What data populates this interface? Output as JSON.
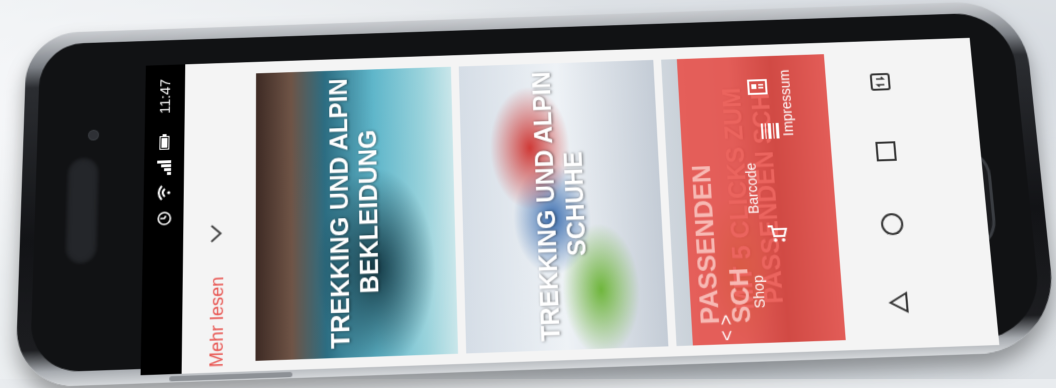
{
  "status_bar": {
    "time": "11:47",
    "icons": [
      "alarm-icon",
      "wifi-icon",
      "signal-icon",
      "battery-icon"
    ]
  },
  "app_bar": {
    "more_label": "Mehr lesen",
    "chevron": "chevron-down-icon"
  },
  "cards": [
    {
      "title": "TREKKING UND ALPIN BEKLEIDUNG"
    },
    {
      "title": "TREKKING UND ALPIN SCHUHE"
    },
    {
      "title": "MIT 5 CLICKS ZUM PASSENDEN SCH"
    }
  ],
  "red_bar": {
    "title_fragment": "PASSENDEN SCH",
    "nav_arrows": "< >",
    "tabs": [
      {
        "label": "Shop",
        "icon": "cart-icon"
      },
      {
        "label": "Barcode",
        "icon": "barcode-icon"
      },
      {
        "label": "Impressum",
        "icon": "info-card-icon"
      }
    ]
  },
  "system_nav": {
    "buttons": [
      "back-icon",
      "home-icon",
      "recents-icon",
      "rotate-icon"
    ]
  },
  "colors": {
    "accent": "#e8534f",
    "red_bar": "#e84e48",
    "screen_bg": "#f4f4f4"
  }
}
